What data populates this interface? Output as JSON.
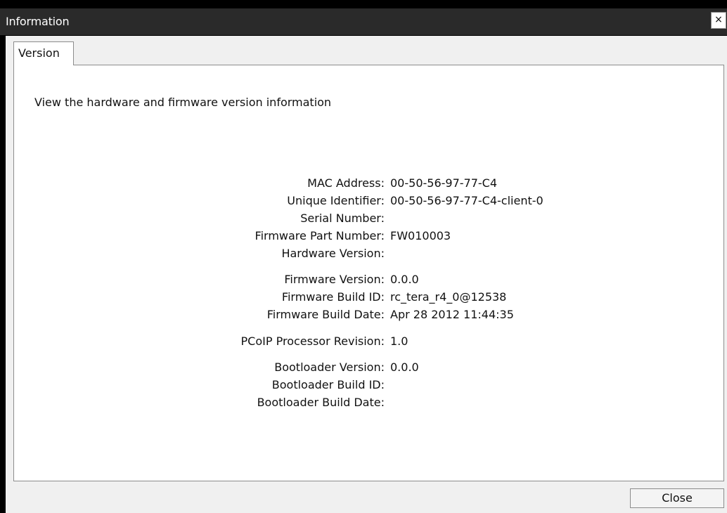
{
  "window": {
    "title": "Information",
    "close_glyph": "×"
  },
  "tabs": [
    {
      "label": "Version",
      "active": true
    }
  ],
  "description": "View the hardware and firmware version information",
  "fields": [
    {
      "label": "MAC Address:",
      "value": "00-50-56-97-77-C4"
    },
    {
      "label": "Unique Identifier:",
      "value": "00-50-56-97-77-C4-client-0"
    },
    {
      "label": "Serial Number:",
      "value": ""
    },
    {
      "label": "Firmware Part Number:",
      "value": "FW010003"
    },
    {
      "label": "Hardware Version:",
      "value": ""
    },
    {
      "label": "Firmware Version:",
      "value": "0.0.0"
    },
    {
      "label": "Firmware Build ID:",
      "value": "rc_tera_r4_0@12538"
    },
    {
      "label": "Firmware Build Date:",
      "value": "Apr 28 2012 11:44:35"
    },
    {
      "label": "PCoIP Processor Revision:",
      "value": "1.0"
    },
    {
      "label": "Bootloader Version:",
      "value": "0.0.0"
    },
    {
      "label": "Bootloader Build ID:",
      "value": ""
    },
    {
      "label": "Bootloader Build Date:",
      "value": ""
    }
  ],
  "footer": {
    "close_label": "Close"
  }
}
